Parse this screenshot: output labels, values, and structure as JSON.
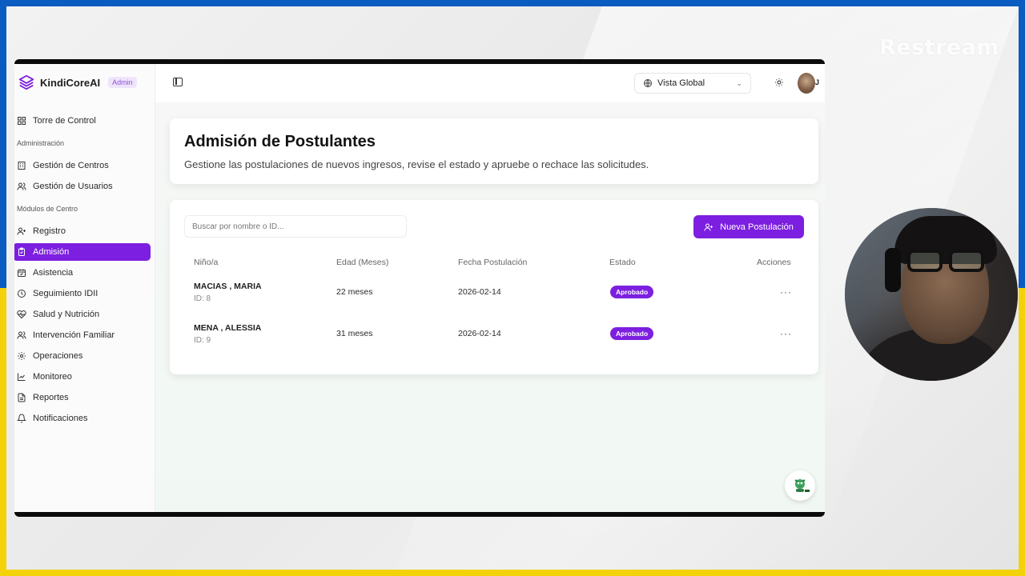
{
  "overlay": {
    "stream_brand": "Restream"
  },
  "app": {
    "name": "KindiCoreAI",
    "role_badge": "Admin",
    "accent": "#7c1fe0"
  },
  "sidebar": {
    "top_item": "Torre de Control",
    "section_admin": "Administración",
    "admin_items": [
      "Gestión de Centros",
      "Gestión de Usuarios"
    ],
    "section_modules": "Módulos de Centro",
    "module_items": [
      "Registro",
      "Admisión",
      "Asistencia",
      "Seguimiento IDII",
      "Salud y Nutrición",
      "Intervención Familiar",
      "Operaciones",
      "Monitoreo",
      "Reportes",
      "Notificaciones"
    ],
    "active_item": "Admisión"
  },
  "topbar": {
    "scope_select": "Vista Global",
    "user_initial": "J"
  },
  "page": {
    "title": "Admisión de Postulantes",
    "subtitle": "Gestione las postulaciones de nuevos ingresos, revise el estado y apruebe o rechace las solicitudes."
  },
  "toolbar": {
    "search_placeholder": "Buscar por nombre o ID...",
    "new_button": "Nueva Postulación"
  },
  "table": {
    "columns": [
      "Niño/a",
      "Edad (Meses)",
      "Fecha Postulación",
      "Estado",
      "Acciones"
    ],
    "rows": [
      {
        "name": "MACIAS , MARIA",
        "id": "ID: 8",
        "age": "22 meses",
        "date": "2026-02-14",
        "status": "Aprobado",
        "actions": "···"
      },
      {
        "name": "MENA , ALESSIA",
        "id": "ID: 9",
        "age": "31 meses",
        "date": "2026-02-14",
        "status": "Aprobado",
        "actions": "···"
      }
    ]
  }
}
